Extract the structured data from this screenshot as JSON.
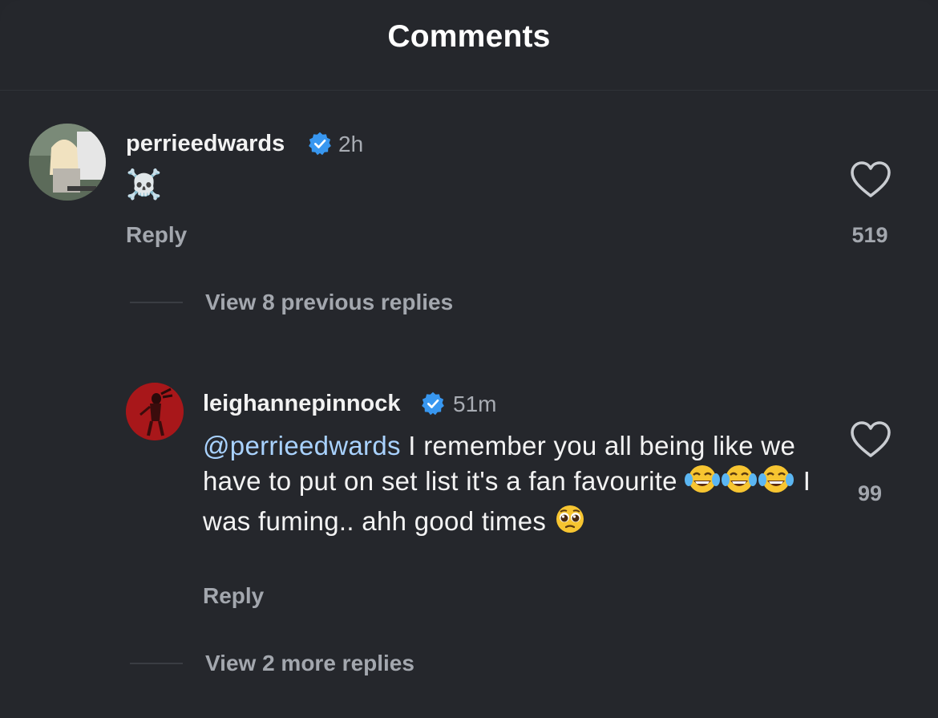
{
  "header": {
    "title": "Comments"
  },
  "comments": [
    {
      "username": "perrieedwards",
      "verified": true,
      "time": "2h",
      "emoji": "☠️",
      "reply_label": "Reply",
      "likes": "519",
      "view_replies": "View 8 previous replies"
    },
    {
      "username": "leighannepinnock",
      "verified": true,
      "time": "51m",
      "mention": "@perrieedwards",
      "text_part1": " I remember you all being like we have to put on set list it's a fan favourite ",
      "text_part2": " I was fuming.. ahh good times ",
      "reply_label": "Reply",
      "likes": "99",
      "view_replies": "View 2 more replies"
    }
  ],
  "colors": {
    "background": "#25272c",
    "verified_badge": "#3897f0",
    "mention": "#a9d2ff",
    "secondary_text": "#a3a7ae"
  },
  "icons": [
    "verified-badge-icon",
    "heart-icon",
    "skull-crossbones-emoji",
    "tears-of-joy-emoji",
    "pleading-face-emoji"
  ]
}
